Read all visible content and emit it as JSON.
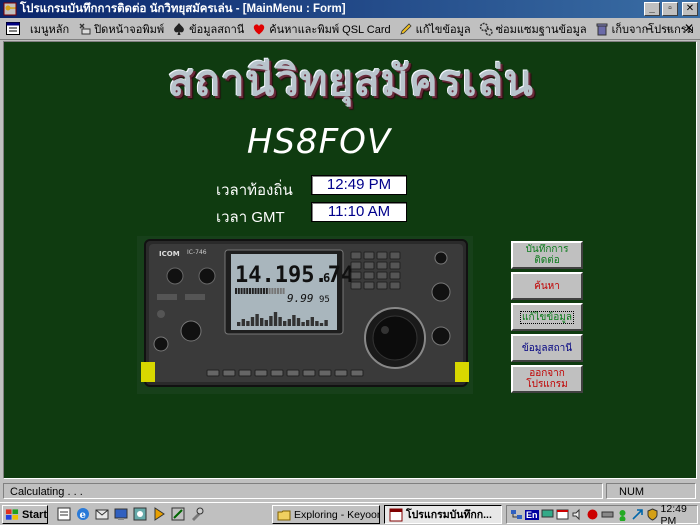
{
  "window": {
    "title": "โปรแกรมบันทึกการติดต่อ นักวิทยุสมัครเล่น - [MainMenu : Form]",
    "buttons": {
      "minimize": "_",
      "restore": "▫",
      "close": "✕"
    }
  },
  "menu": {
    "items": [
      {
        "label": "เมนูหลัก",
        "icon": "form-icon"
      },
      {
        "label": "ปิดหน้าจอพิมพ์",
        "icon": "printer-close-icon"
      },
      {
        "label": "ข้อมูลสถานี",
        "icon": "spade-icon"
      },
      {
        "label": "ค้นหาและพิมพ์ QSL Card",
        "icon": "heart-icon"
      },
      {
        "label": "แก้ไขข้อมูล",
        "icon": "pencil-icon"
      },
      {
        "label": "ซ่อมแซมฐานข้อมูล",
        "icon": "gears-icon"
      },
      {
        "label": "เก็บจากโปรแกรม",
        "icon": "trash-icon"
      }
    ],
    "window_controls": {
      "minimize": "–",
      "restore": "▫",
      "close": "✕"
    }
  },
  "form": {
    "title": "สถานีวิทยุสมัครเล่น",
    "callsign": "HS8FOV",
    "local_time_label": "เวลาท้องถิ่น",
    "local_time": "12:49 PM",
    "gmt_time_label": "เวลา GMT",
    "gmt_time": "11:10 AM"
  },
  "radio": {
    "brand": "ICOM",
    "model": "IC-746",
    "frequency": "14.195.74",
    "sub_digit": "6",
    "meter_reading": "9.99",
    "meter_unit": "95"
  },
  "side_buttons": {
    "log_contact": "บันทึกการติดต่อ",
    "search": "ค้นหา",
    "edit_data": "แก้ไขข้อมูล",
    "station_info": "ข้อมูลสถานี",
    "exit_program": "ออกจากโปรแกรม"
  },
  "status": {
    "text": "Calculating . . .",
    "num": "NUM"
  },
  "taskbar": {
    "start": "Start",
    "tasks": [
      {
        "label": "Exploring - Keyoon",
        "icon": "folder-icon"
      },
      {
        "label": "โปรแกรมบันทึกก...",
        "icon": "access-form-icon"
      }
    ],
    "tray_lang": "En",
    "clock": "12:49 PM"
  },
  "colors": {
    "form_background": "#0f3b10",
    "title_bar": "#0a246a",
    "time_text": "#00008b",
    "button_green": "#0a7a1a",
    "button_red": "#c00000"
  }
}
